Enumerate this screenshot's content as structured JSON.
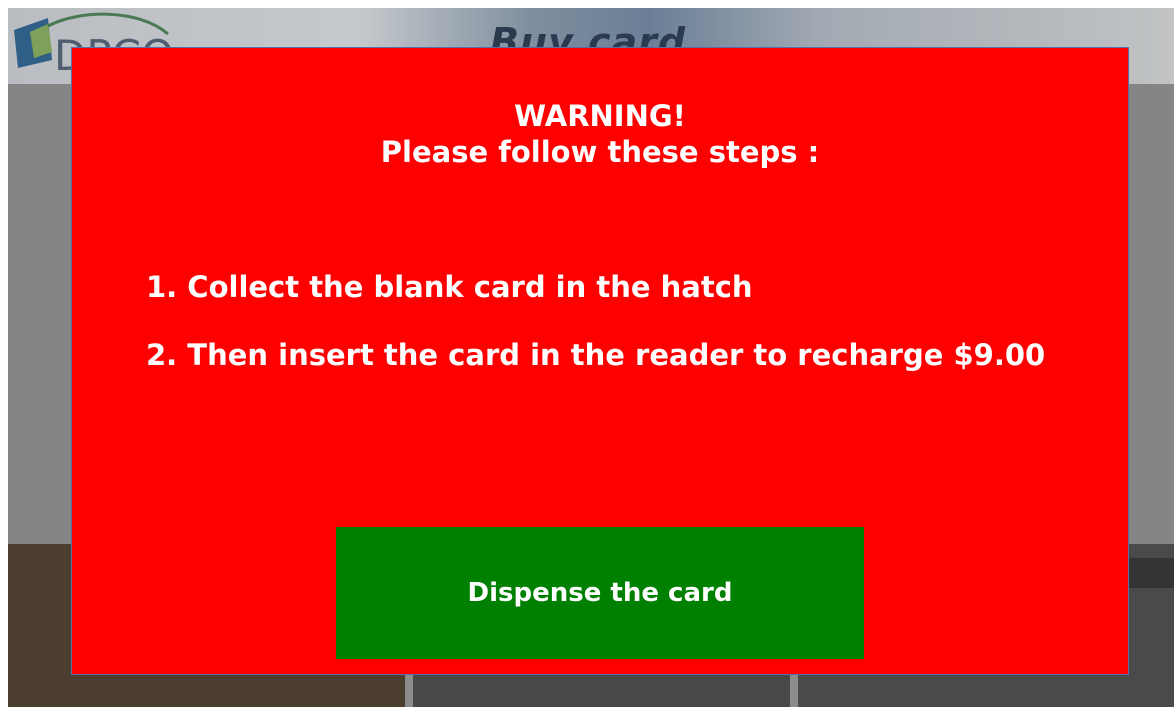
{
  "background": {
    "logo_text": "DPCO",
    "title": "Buy card"
  },
  "modal": {
    "title_line1": "WARNING!",
    "title_line2": "Please follow these steps :",
    "steps": [
      "1. Collect the blank card in the hatch",
      "2. Then insert the card in the reader to recharge $9.00"
    ],
    "dispense_label": "Dispense the card"
  },
  "colors": {
    "modal_background": "#ff0000",
    "button_background": "#008000",
    "text": "#ffffff"
  }
}
